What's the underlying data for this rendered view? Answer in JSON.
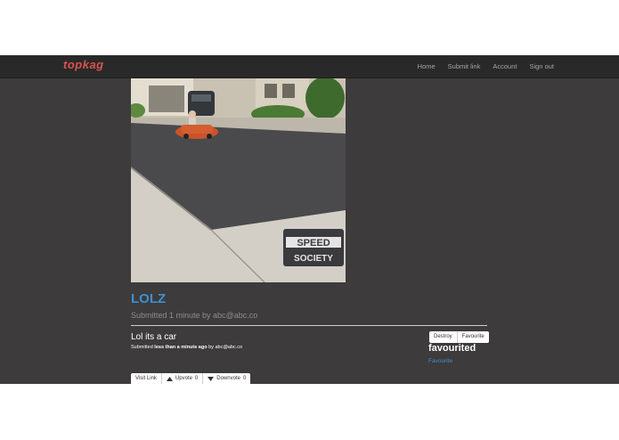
{
  "nav": {
    "logo": "topkag",
    "links": [
      "Home",
      "Submit link",
      "Account",
      "Sign out"
    ]
  },
  "post": {
    "title": "LOLZ",
    "meta": "Submitted 1 minute by abc@abc.co",
    "watermark": "SPEED SOCIETY"
  },
  "comment": {
    "text": "Lol its a car",
    "meta_prefix": "Submitted",
    "meta_time": "less than a minute ago",
    "meta_by": "by abc@abc.co"
  },
  "actions": {
    "destroy": "Destroy",
    "favourite_button": "Favourite",
    "status": "favourited",
    "favourite_link": "Favourite"
  },
  "vote": {
    "visit": "Visit Link",
    "upvote_label": "Upvote",
    "upvote_count": "0",
    "downvote_label": "Downvote",
    "downvote_count": "0"
  },
  "colors": {
    "accent": "#3f8fd2",
    "brand": "#d9534f",
    "background": "#3d3b3b",
    "navbar": "#2a2929"
  }
}
